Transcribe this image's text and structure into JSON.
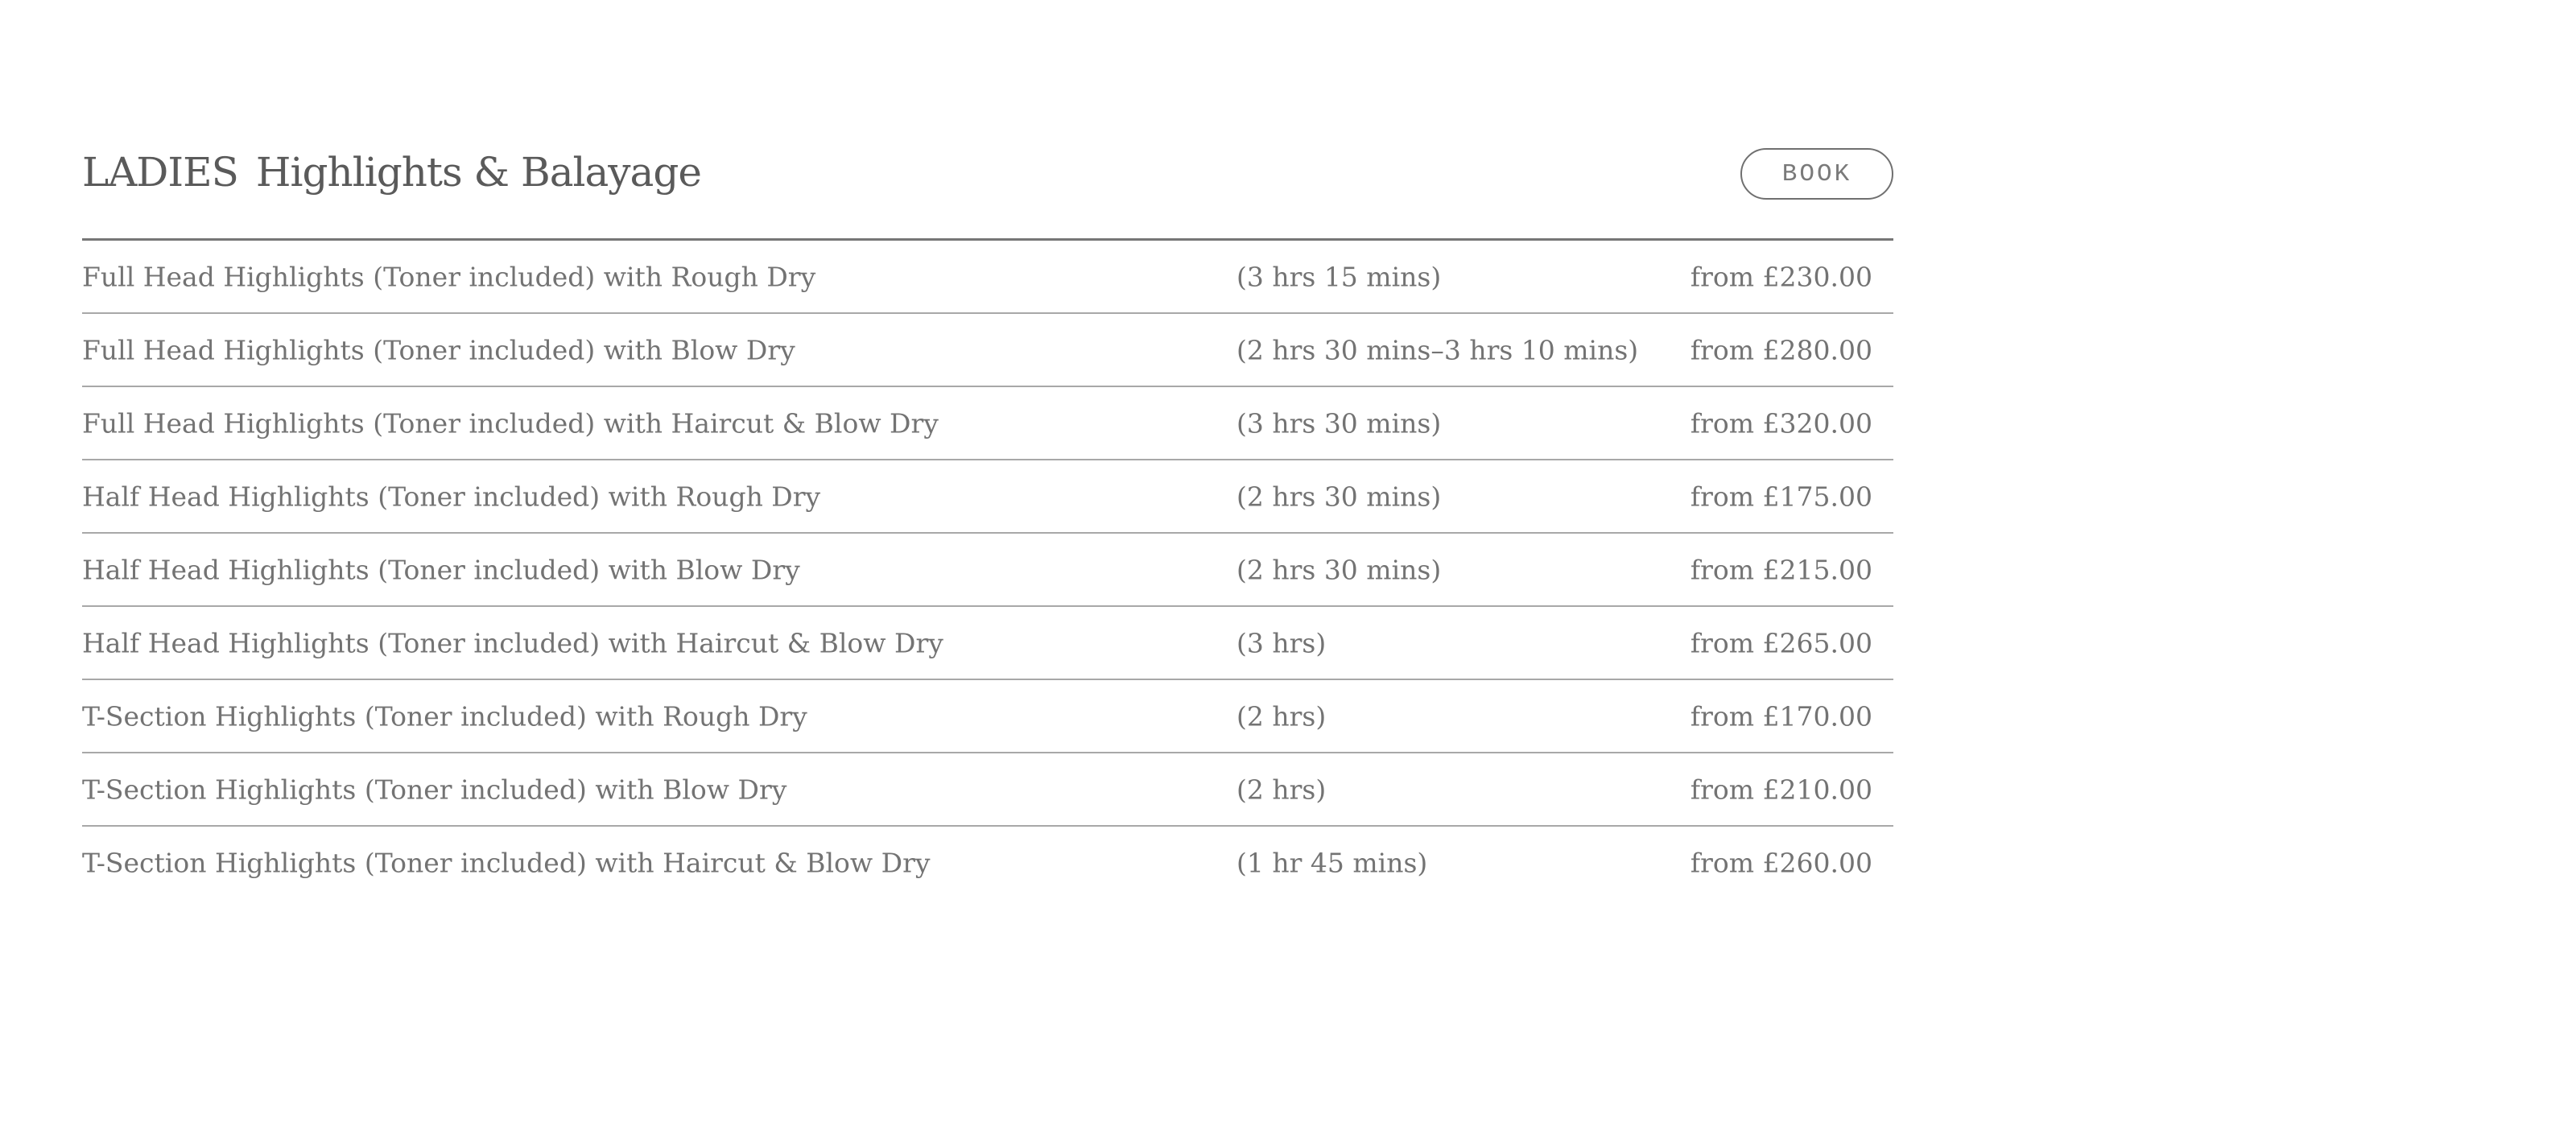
{
  "section": {
    "category": "LADIES",
    "title": "Highlights & Balayage",
    "book_label": "BOOK"
  },
  "services": [
    {
      "name": "Full Head Highlights (Toner included) with Rough Dry",
      "duration": "(3 hrs 15 mins)",
      "price": "from £230.00"
    },
    {
      "name": "Full Head Highlights (Toner included) with Blow Dry",
      "duration": "(2 hrs 30 mins–3 hrs 10 mins)",
      "price": "from £280.00"
    },
    {
      "name": "Full Head Highlights (Toner included) with Haircut & Blow Dry",
      "duration": "(3 hrs 30 mins)",
      "price": "from £320.00"
    },
    {
      "name": "Half Head Highlights (Toner included) with Rough Dry",
      "duration": "(2 hrs 30 mins)",
      "price": "from £175.00"
    },
    {
      "name": "Half Head Highlights (Toner included) with Blow Dry",
      "duration": "(2 hrs 30 mins)",
      "price": "from £215.00"
    },
    {
      "name": "Half Head Highlights (Toner included) with Haircut & Blow Dry",
      "duration": "(3 hrs)",
      "price": "from £265.00"
    },
    {
      "name": "T-Section Highlights (Toner included) with Rough Dry",
      "duration": "(2 hrs)",
      "price": "from £170.00"
    },
    {
      "name": "T-Section Highlights (Toner included) with Blow Dry",
      "duration": "(2 hrs)",
      "price": "from £210.00"
    },
    {
      "name": "T-Section Highlights (Toner included) with Haircut & Blow Dry",
      "duration": "(1 hr 45 mins)",
      "price": "from £260.00"
    }
  ]
}
